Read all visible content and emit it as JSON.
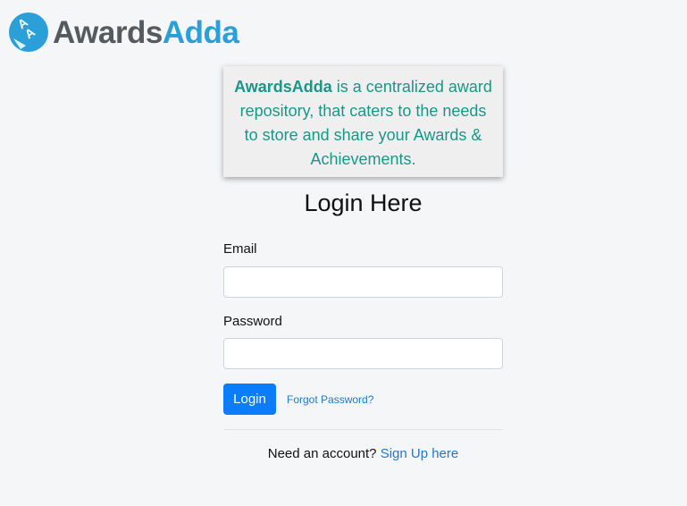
{
  "brand": {
    "name_part1": "Awards",
    "name_part2": "Adda",
    "colors": {
      "dark": "#575a5d",
      "blue": "#2a9fd8",
      "teal": "#1a9688",
      "primary": "#0b7dfc",
      "link": "#1e78d0"
    },
    "logo_icon": "awardsadda-logo-icon"
  },
  "intro": {
    "brand_name": "AwardsAdda",
    "text": " is a centralized award repository, that caters to the needs to store and share your Awards & Achievements."
  },
  "login": {
    "title": "Login Here",
    "email_label": "Email",
    "email_value": "",
    "password_label": "Password",
    "password_value": "",
    "submit_label": "Login",
    "forgot_label": "Forgot Password?",
    "signup_prompt": "Need an account? ",
    "signup_link": "Sign Up here"
  }
}
